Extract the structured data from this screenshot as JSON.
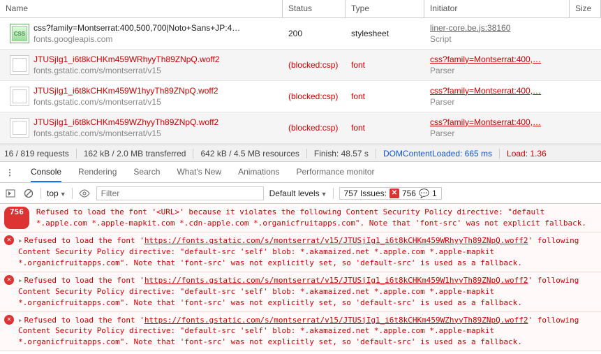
{
  "network": {
    "headers": {
      "name": "Name",
      "status": "Status",
      "type": "Type",
      "initiator": "Initiator",
      "size": "Size"
    },
    "rows": [
      {
        "icon": "css",
        "name": "css?family=Montserrat:400,500,700|Noto+Sans+JP:4…",
        "host": "fonts.googleapis.com",
        "status": "200",
        "type": "stylesheet",
        "init": "liner-core.be.js:38160",
        "initSub": "Script",
        "red": false,
        "initIsLink": true
      },
      {
        "icon": "page",
        "name": "JTUSjIg1_i6t8kCHKm459WRhyyTh89ZNpQ.woff2",
        "host": "fonts.gstatic.com/s/montserrat/v15",
        "status": "(blocked:csp)",
        "type": "font",
        "init": "css?family=Montserrat:400,…",
        "initSub": "Parser",
        "red": true,
        "initIsLink": true
      },
      {
        "icon": "page",
        "name": "JTUSjIg1_i6t8kCHKm459W1hyyTh89ZNpQ.woff2",
        "host": "fonts.gstatic.com/s/montserrat/v15",
        "status": "(blocked:csp)",
        "type": "font",
        "init": "css?family=Montserrat:400,…",
        "initSub": "Parser",
        "red": true,
        "initIsLink": true
      },
      {
        "icon": "page",
        "name": "JTUSjIg1_i6t8kCHKm459WZhyyTh89ZNpQ.woff2",
        "host": "fonts.gstatic.com/s/montserrat/v15",
        "status": "(blocked:csp)",
        "type": "font",
        "init": "css?family=Montserrat:400,…",
        "initSub": "Parser",
        "red": true,
        "initIsLink": true
      }
    ]
  },
  "statusbar": {
    "requests": "16 / 819 requests",
    "transferred": "162 kB / 2.0 MB transferred",
    "resources": "642 kB / 4.5 MB resources",
    "finish": "Finish: 48.57 s",
    "dcl": "DOMContentLoaded: 665 ms",
    "load": "Load: 1.36"
  },
  "tabs": [
    "Console",
    "Rendering",
    "Search",
    "What's New",
    "Animations",
    "Performance monitor"
  ],
  "toolbar": {
    "top": "top",
    "filterPlaceholder": "Filter",
    "defaultLevels": "Default levels",
    "issuesLabel": "757 Issues:",
    "errCount": "756",
    "chatCount": "1"
  },
  "console": {
    "badge": "756",
    "summary": "Refused to load the font '<URL>' because it violates the following Content Security Policy directive: \"default *.apple.com *.apple-mapkit.com *.cdn-apple.com *.organicfruitapps.com\". Note that 'font-src' was not explicit fallback.",
    "messages": [
      {
        "pre": "Refused to load the font '",
        "url": "https://fonts.gstatic.com/s/montserrat/v15/JTUSjIg1_i6t8kCHKm459WRhyyTh89ZNpQ.woff2",
        "post": "' following Content Security Policy directive: \"default-src 'self' blob: *.akamaized.net *.apple.com *.apple-mapkit *.organicfruitapps.com\". Note that 'font-src' was not explicitly set, so 'default-src' is used as a fallback."
      },
      {
        "pre": "Refused to load the font '",
        "url": "https://fonts.gstatic.com/s/montserrat/v15/JTUSjIg1_i6t8kCHKm459W1hyyTh89ZNpQ.woff2",
        "post": "' following Content Security Policy directive: \"default-src 'self' blob: *.akamaized.net *.apple.com *.apple-mapkit *.organicfruitapps.com\". Note that 'font-src' was not explicitly set, so 'default-src' is used as a fallback."
      },
      {
        "pre": "Refused to load the font '",
        "url": "https://fonts.gstatic.com/s/montserrat/v15/JTUSjIg1_i6t8kCHKm459WZhyyTh89ZNpQ.woff2",
        "post": "' following Content Security Policy directive: \"default-src 'self' blob: *.akamaized.net *.apple.com *.apple-mapkit *.organicfruitapps.com\". Note that 'font-src' was not explicitly set, so 'default-src' is used as a fallback."
      }
    ]
  }
}
